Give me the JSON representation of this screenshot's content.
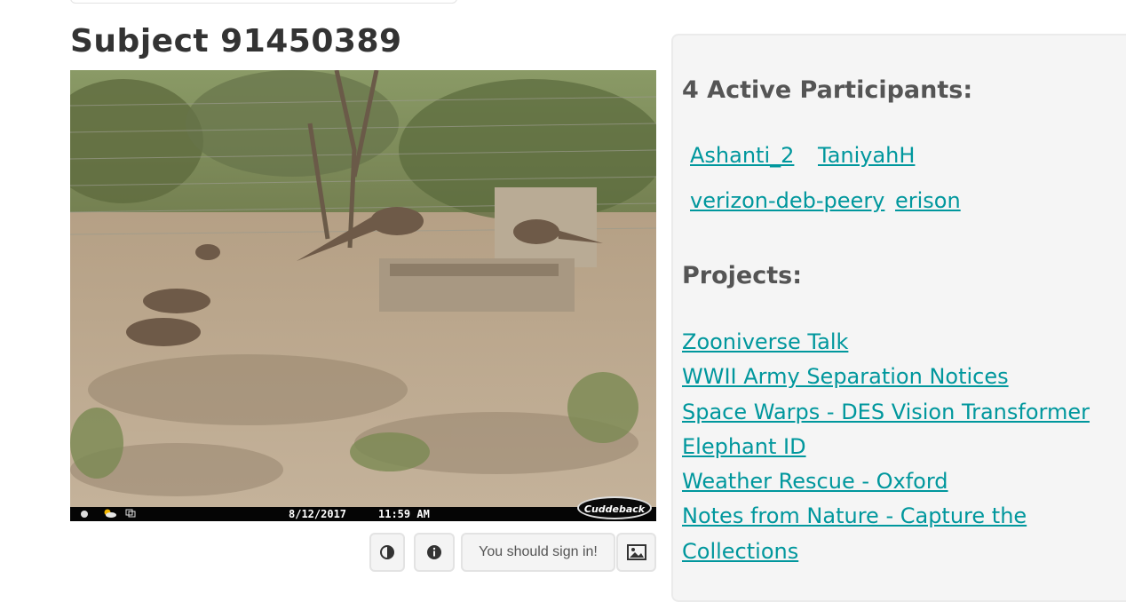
{
  "subject": {
    "title": "Subject 91450389",
    "image_overlay": {
      "date": "8/12/2017",
      "time": "11:59 AM",
      "brand": "Cuddeback"
    }
  },
  "toolbar": {
    "contrast_icon": "contrast-icon",
    "info_icon": "info-icon",
    "signin_label": "You should sign in!",
    "image_icon": "image-icon"
  },
  "sidebar": {
    "participants_heading": "4 Active Participants:",
    "participants": [
      "Ashanti_2",
      "TaniyahH",
      "verizon-deb-peery",
      "erison"
    ],
    "projects_heading": "Projects:",
    "projects": [
      "Zooniverse Talk",
      "WWII Army Separation Notices",
      "Space Warps - DES Vision Transformer",
      "Elephant ID",
      "Weather Rescue - Oxford",
      "Notes from Nature - Capture the Collections"
    ]
  },
  "colors": {
    "link": "#00979d",
    "heading": "#555555",
    "sidebar_bg": "#f5f5f5"
  }
}
